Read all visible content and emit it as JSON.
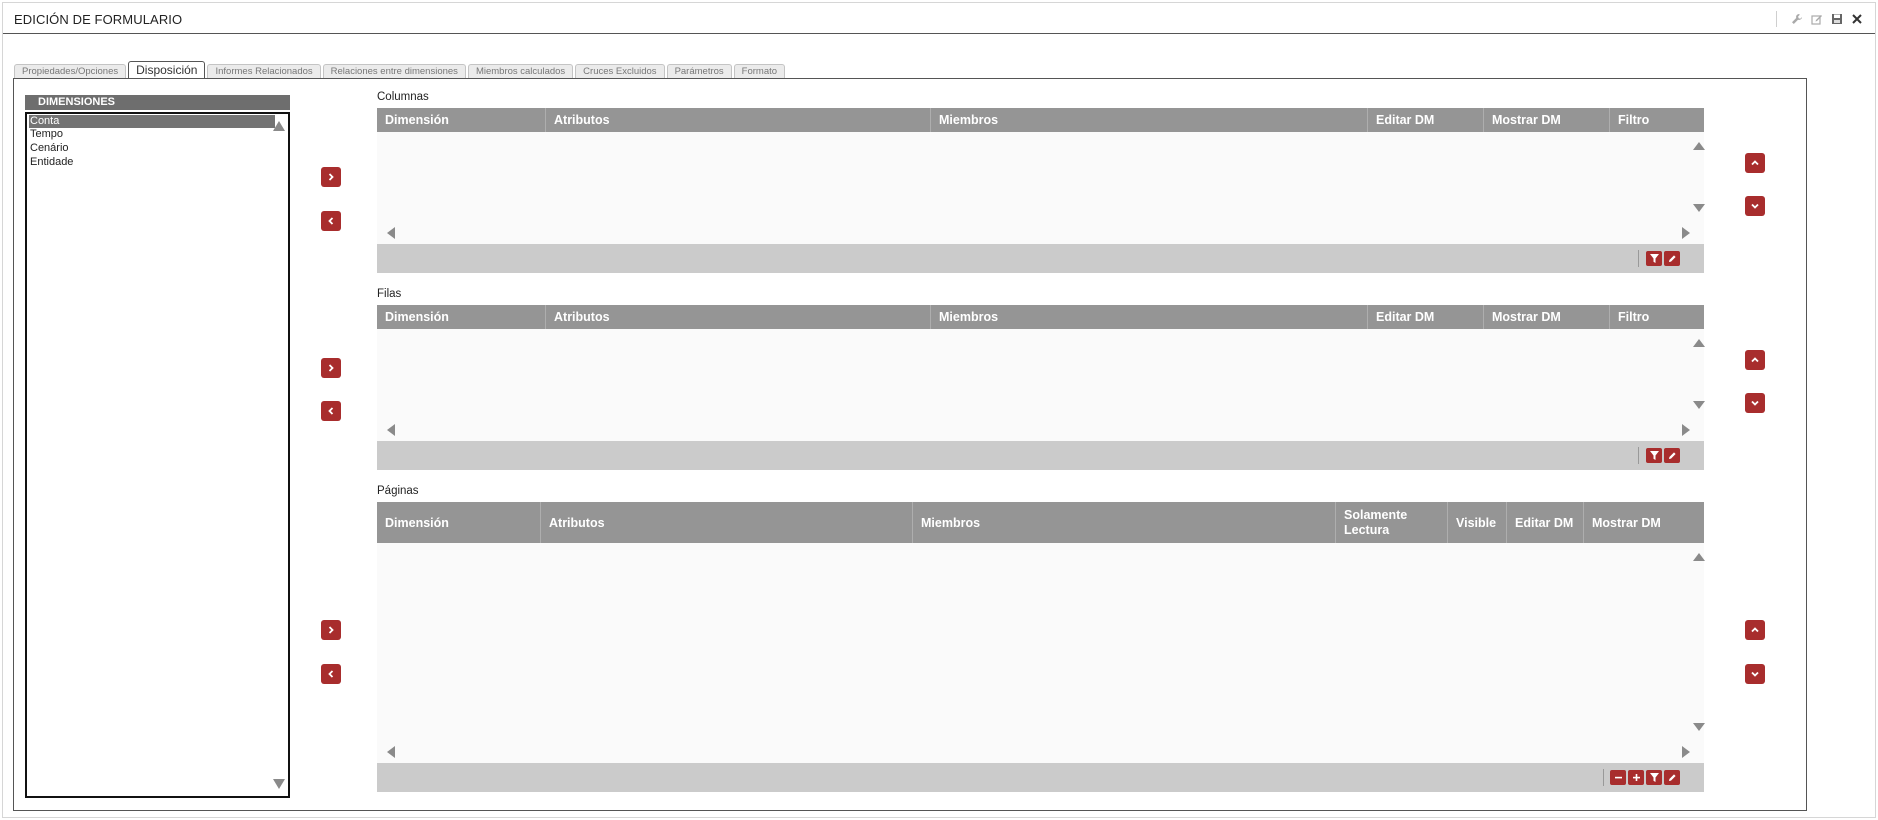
{
  "window": {
    "title": "EDICIÓN DE FORMULARIO"
  },
  "window_controls": [
    "wrench-icon",
    "edit-icon",
    "save-icon",
    "close-icon"
  ],
  "tabs": [
    {
      "label": "Propiedades/Opciones",
      "active": false
    },
    {
      "label": "Disposición",
      "active": true
    },
    {
      "label": "Informes Relacionados",
      "active": false
    },
    {
      "label": "Relaciones entre dimensiones",
      "active": false
    },
    {
      "label": "Miembros calculados",
      "active": false
    },
    {
      "label": "Cruces Excluidos",
      "active": false
    },
    {
      "label": "Parámetros",
      "active": false
    },
    {
      "label": "Formato",
      "active": false
    }
  ],
  "dimensions": {
    "header": "DIMENSIONES",
    "items": [
      "Conta",
      "Tempo",
      "Cenário",
      "Entidade"
    ],
    "selected_index": 0
  },
  "columns": {
    "label": "Columnas",
    "headers": [
      "Dimensión",
      "Atributos",
      "Miembros",
      "Editar DM",
      "Mostrar DM",
      "Filtro"
    ],
    "rows": []
  },
  "rows": {
    "label": "Filas",
    "headers": [
      "Dimensión",
      "Atributos",
      "Miembros",
      "Editar DM",
      "Mostrar DM",
      "Filtro"
    ],
    "rows": []
  },
  "pages": {
    "label": "Páginas",
    "headers": [
      "Dimensión",
      "Atributos",
      "Miembros",
      "Solamente Lectura",
      "Visible",
      "Editar DM",
      "Mostrar DM"
    ],
    "rows": []
  },
  "colors": {
    "accent_red": "#a82d2d",
    "grid_header": "#959595",
    "grid_footer": "#cbcbcb",
    "selected_item": "#737373"
  }
}
